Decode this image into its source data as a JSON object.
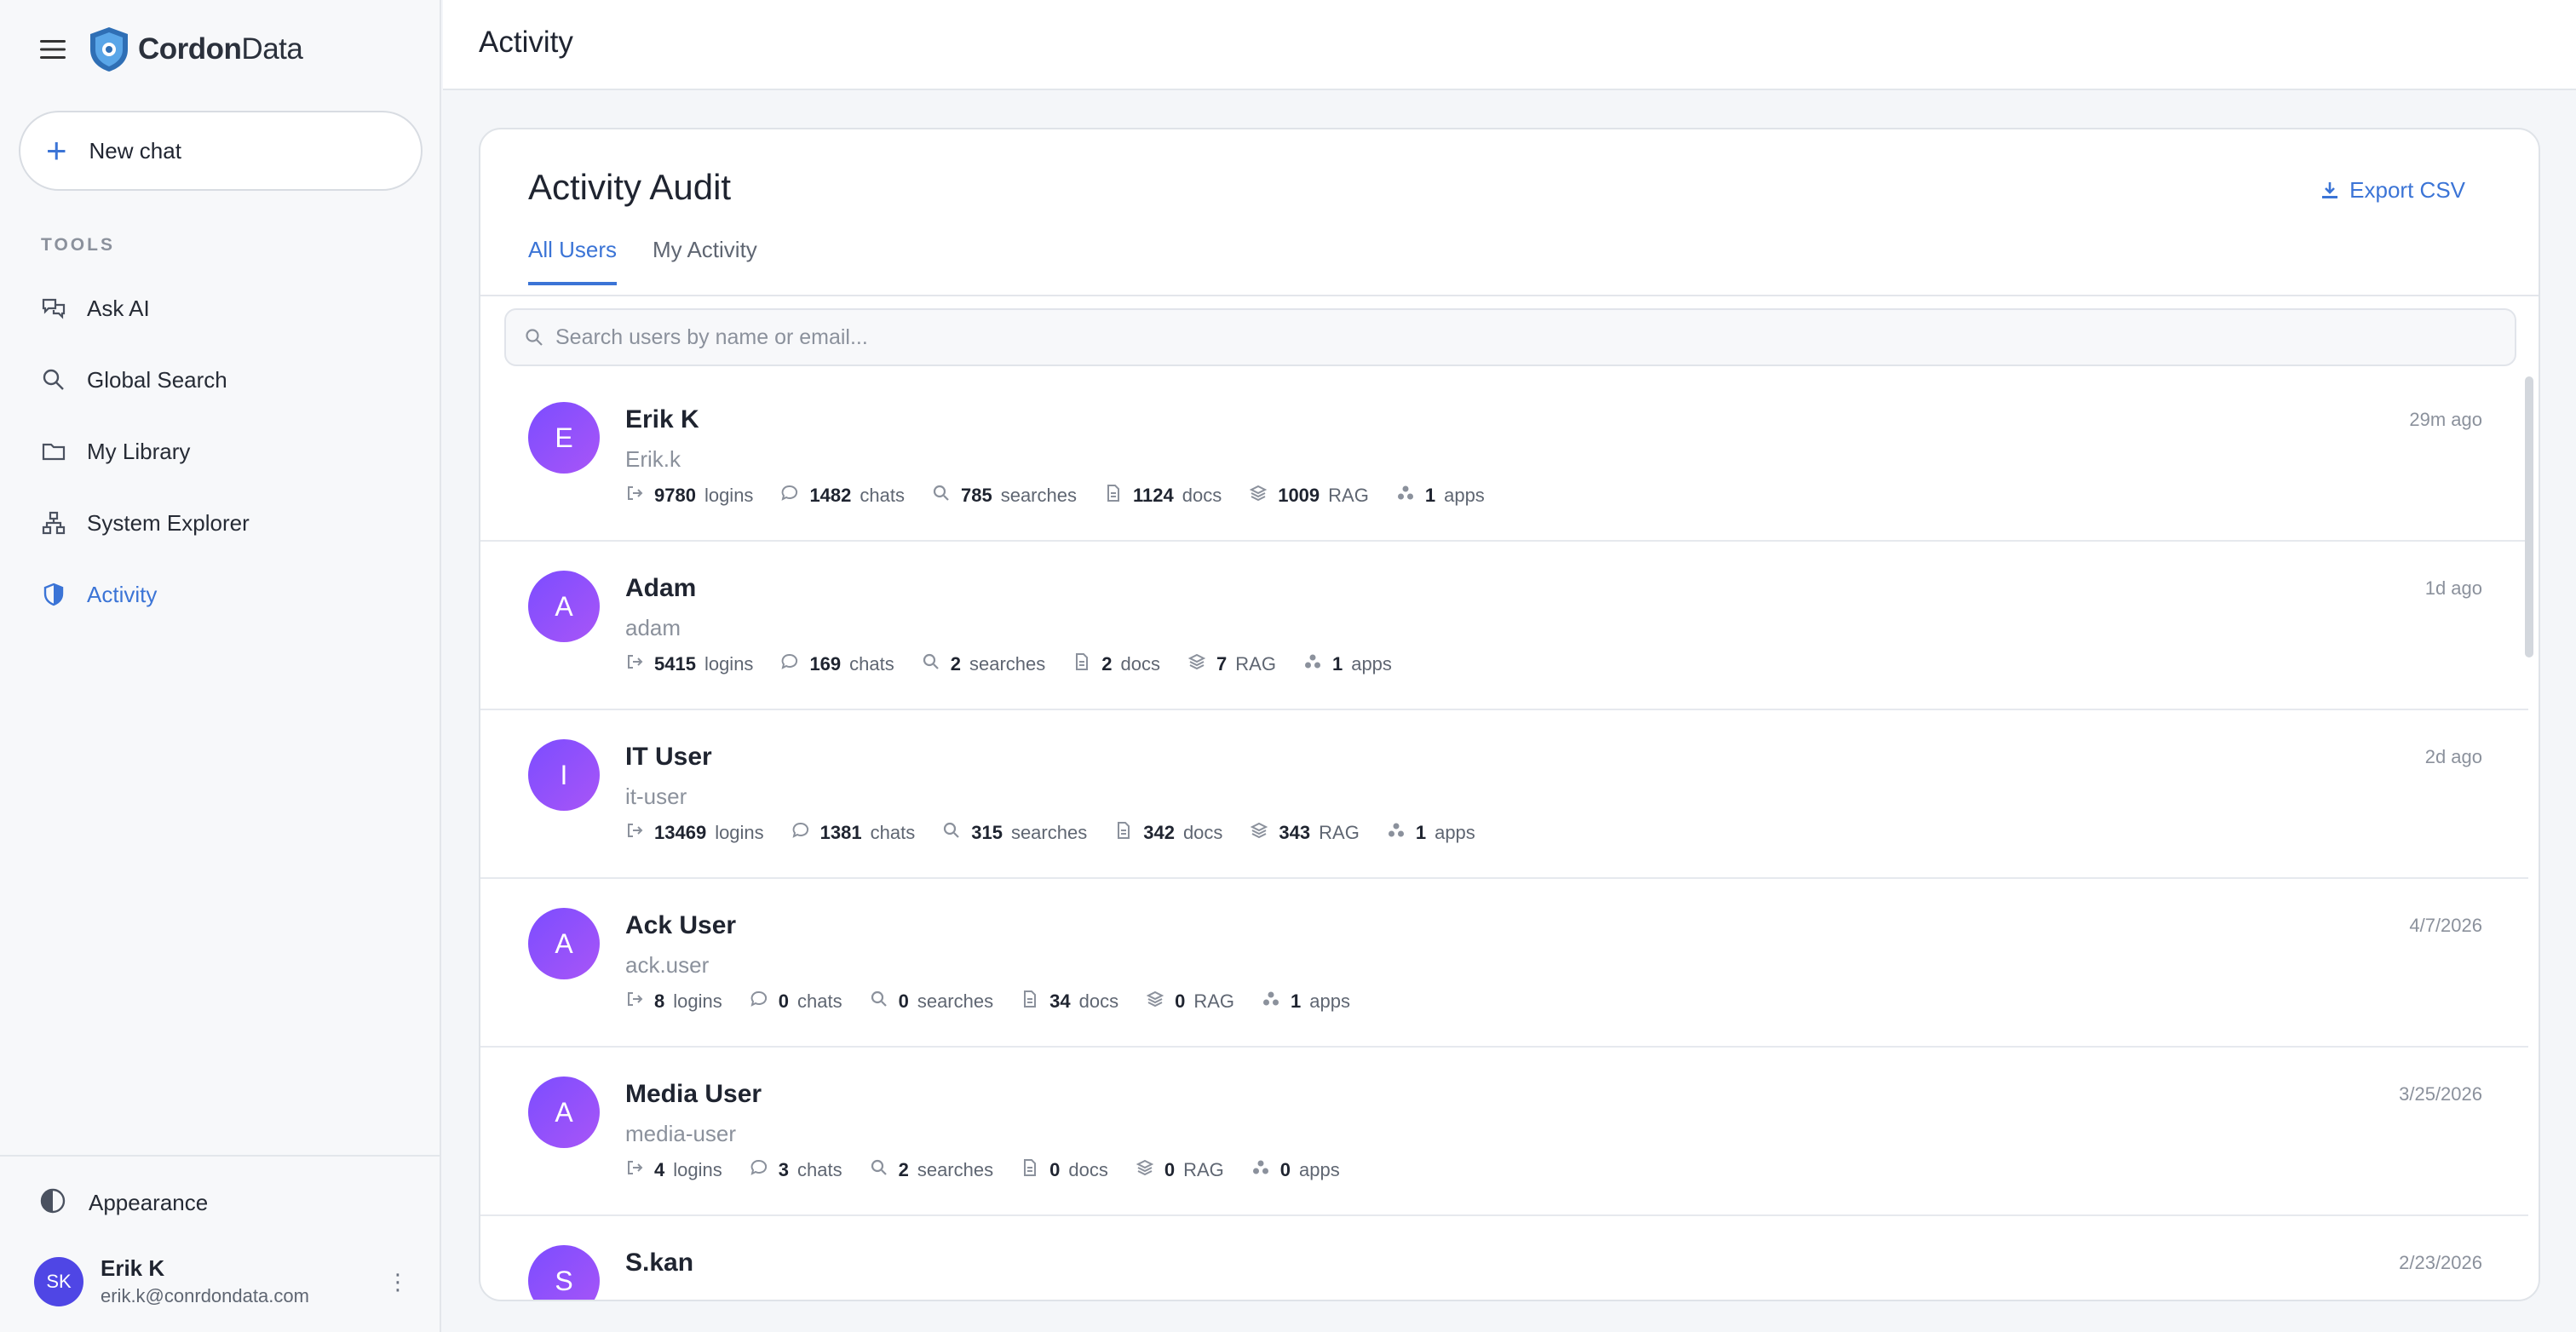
{
  "brand": {
    "name_bold": "Cordon",
    "name_thin": "Data"
  },
  "sidebar": {
    "new_chat": "New chat",
    "tools_title": "TOOLS",
    "items": [
      {
        "label": "Ask AI",
        "icon": "chat-bubbles-icon",
        "active": false
      },
      {
        "label": "Global Search",
        "icon": "search-icon",
        "active": false
      },
      {
        "label": "My Library",
        "icon": "folder-icon",
        "active": false
      },
      {
        "label": "System Explorer",
        "icon": "network-icon",
        "active": false
      },
      {
        "label": "Activity",
        "icon": "shield-icon",
        "active": true
      }
    ],
    "appearance": "Appearance",
    "user": {
      "initials": "SK",
      "name": "Erik K",
      "email": "erik.k@conrdondata.com"
    }
  },
  "topbar": {
    "title": "Activity"
  },
  "card": {
    "title": "Activity Audit",
    "export_label": "Export CSV",
    "tabs": [
      "All Users",
      "My Activity"
    ],
    "search_placeholder": "Search users by name or email..."
  },
  "stat_labels": {
    "logins": "logins",
    "chats": "chats",
    "searches": "searches",
    "docs": "docs",
    "rag": "RAG",
    "apps": "apps"
  },
  "users": [
    {
      "initial": "E",
      "name": "Erik K",
      "handle": "Erik.k",
      "when": "29m ago",
      "logins": "9780",
      "chats": "1482",
      "searches": "785",
      "docs": "1124",
      "rag": "1009",
      "apps": "1"
    },
    {
      "initial": "A",
      "name": "Adam",
      "handle": "adam",
      "when": "1d ago",
      "logins": "5415",
      "chats": "169",
      "searches": "2",
      "docs": "2",
      "rag": "7",
      "apps": "1"
    },
    {
      "initial": "I",
      "name": "IT User",
      "handle": "it-user",
      "when": "2d ago",
      "logins": "13469",
      "chats": "1381",
      "searches": "315",
      "docs": "342",
      "rag": "343",
      "apps": "1"
    },
    {
      "initial": "A",
      "name": "Ack User",
      "handle": "ack.user",
      "when": "4/7/2026",
      "logins": "8",
      "chats": "0",
      "searches": "0",
      "docs": "34",
      "rag": "0",
      "apps": "1"
    },
    {
      "initial": "A",
      "name": "Media User",
      "handle": "media-user",
      "when": "3/25/2026",
      "logins": "4",
      "chats": "3",
      "searches": "2",
      "docs": "0",
      "rag": "0",
      "apps": "0"
    },
    {
      "initial": "S",
      "name": "S.kan",
      "handle": "",
      "when": "2/23/2026",
      "logins": "",
      "chats": "",
      "searches": "",
      "docs": "",
      "rag": "",
      "apps": ""
    }
  ],
  "colors": {
    "accent": "#3b74d6",
    "avatar_gradient_start": "#7c4dff",
    "avatar_gradient_end": "#a855f7"
  }
}
